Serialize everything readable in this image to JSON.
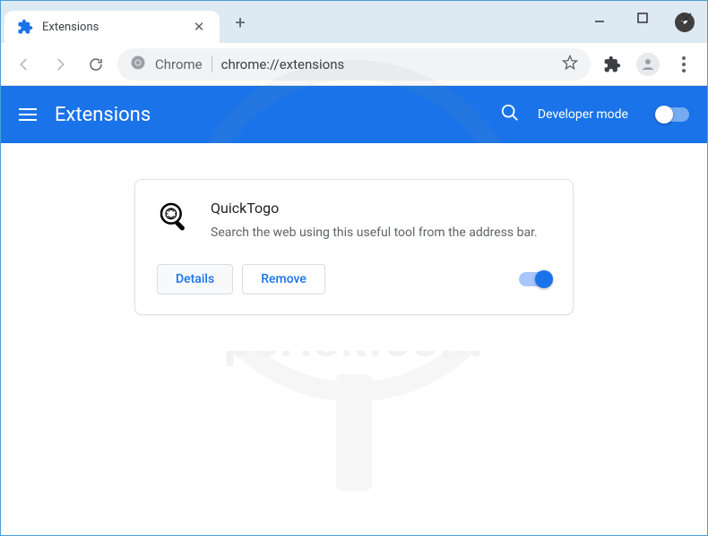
{
  "tab": {
    "title": "Extensions"
  },
  "omnibox": {
    "prefix": "Chrome",
    "url": "chrome://extensions"
  },
  "header": {
    "title": "Extensions",
    "dev_mode_label": "Developer mode",
    "dev_mode_on": false
  },
  "extension": {
    "name": "QuickTogo",
    "description": "Search the web using this useful tool from the address bar.",
    "details_label": "Details",
    "remove_label": "Remove",
    "enabled": true
  },
  "watermark": "pcrisk.com"
}
